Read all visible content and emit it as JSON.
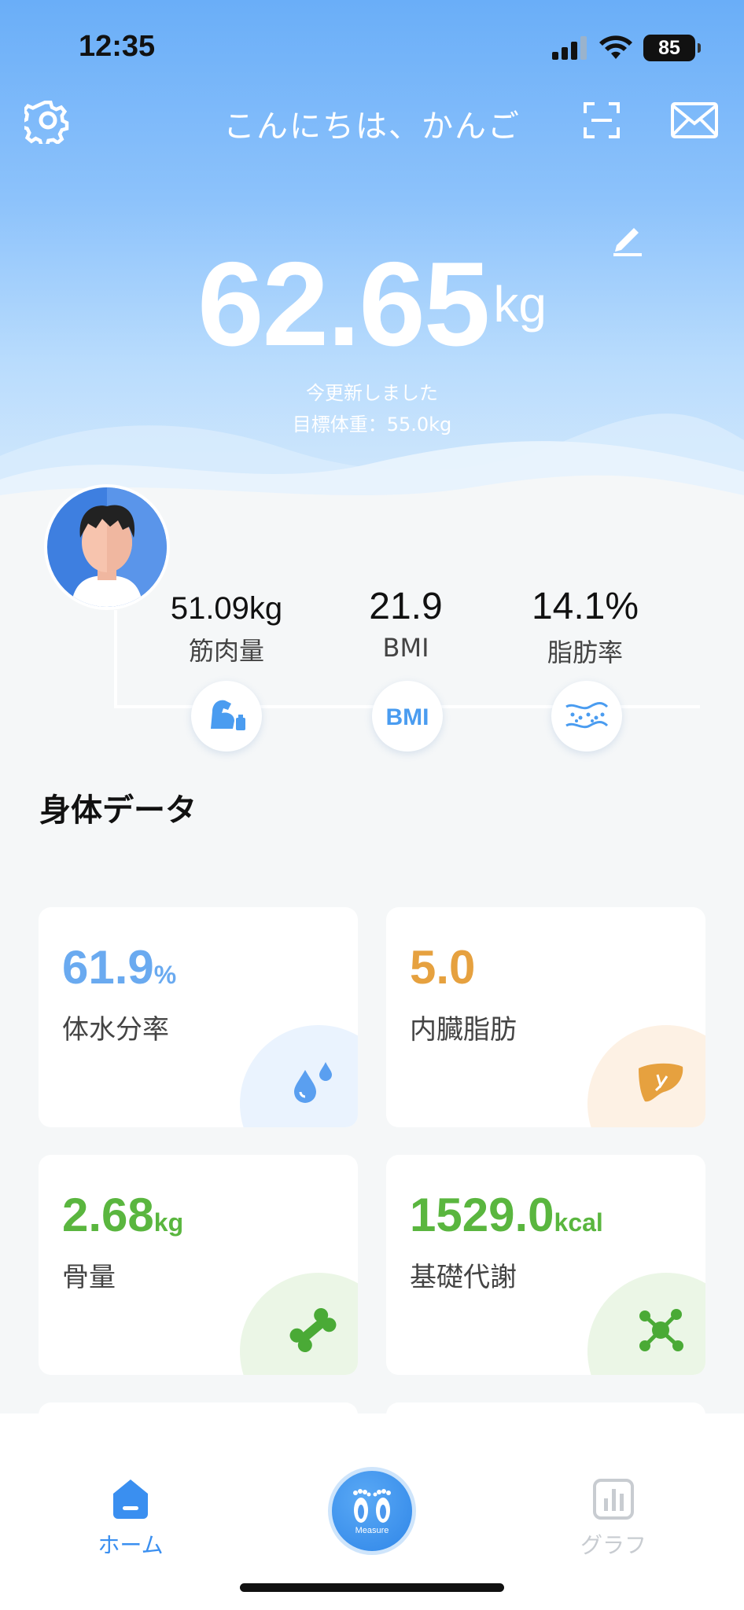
{
  "status_bar": {
    "time": "12:35",
    "battery": "85"
  },
  "header": {
    "greeting": "こんにちは、かんご",
    "settings_icon": "gear-icon",
    "scan_icon": "scan-icon",
    "mail_icon": "mail-icon"
  },
  "weight": {
    "value": "62.65",
    "unit": "kg",
    "updated": "今更新しました",
    "target": "目標体重：55.0kg"
  },
  "metrics": [
    {
      "value": "51.09kg",
      "label": "筋肉量",
      "icon": "muscle-icon"
    },
    {
      "value": "21.9",
      "label": "BMI",
      "icon": "bmi-icon"
    },
    {
      "value": "14.1%",
      "label": "脂肪率",
      "icon": "fat-icon"
    }
  ],
  "section_title": "身体データ",
  "cards": [
    {
      "value": "61.9",
      "unit": "%",
      "label": "体水分率",
      "color": "#6aaaf0",
      "icon": "water-drops-icon"
    },
    {
      "value": "5.0",
      "unit": "",
      "label": "内臓脂肪",
      "color": "#e6a13f",
      "icon": "liver-icon"
    },
    {
      "value": "2.68",
      "unit": "kg",
      "label": "骨量",
      "color": "#5ab63f",
      "icon": "bone-icon"
    },
    {
      "value": "1529.0",
      "unit": "kcal",
      "label": "基礎代謝",
      "color": "#5ab63f",
      "icon": "molecule-icon"
    }
  ],
  "tabbar": {
    "home": "ホーム",
    "measure": "Measure",
    "graph": "グラフ"
  },
  "colors": {
    "accent": "#3a8ff0",
    "inactive": "#c8ccd1"
  }
}
